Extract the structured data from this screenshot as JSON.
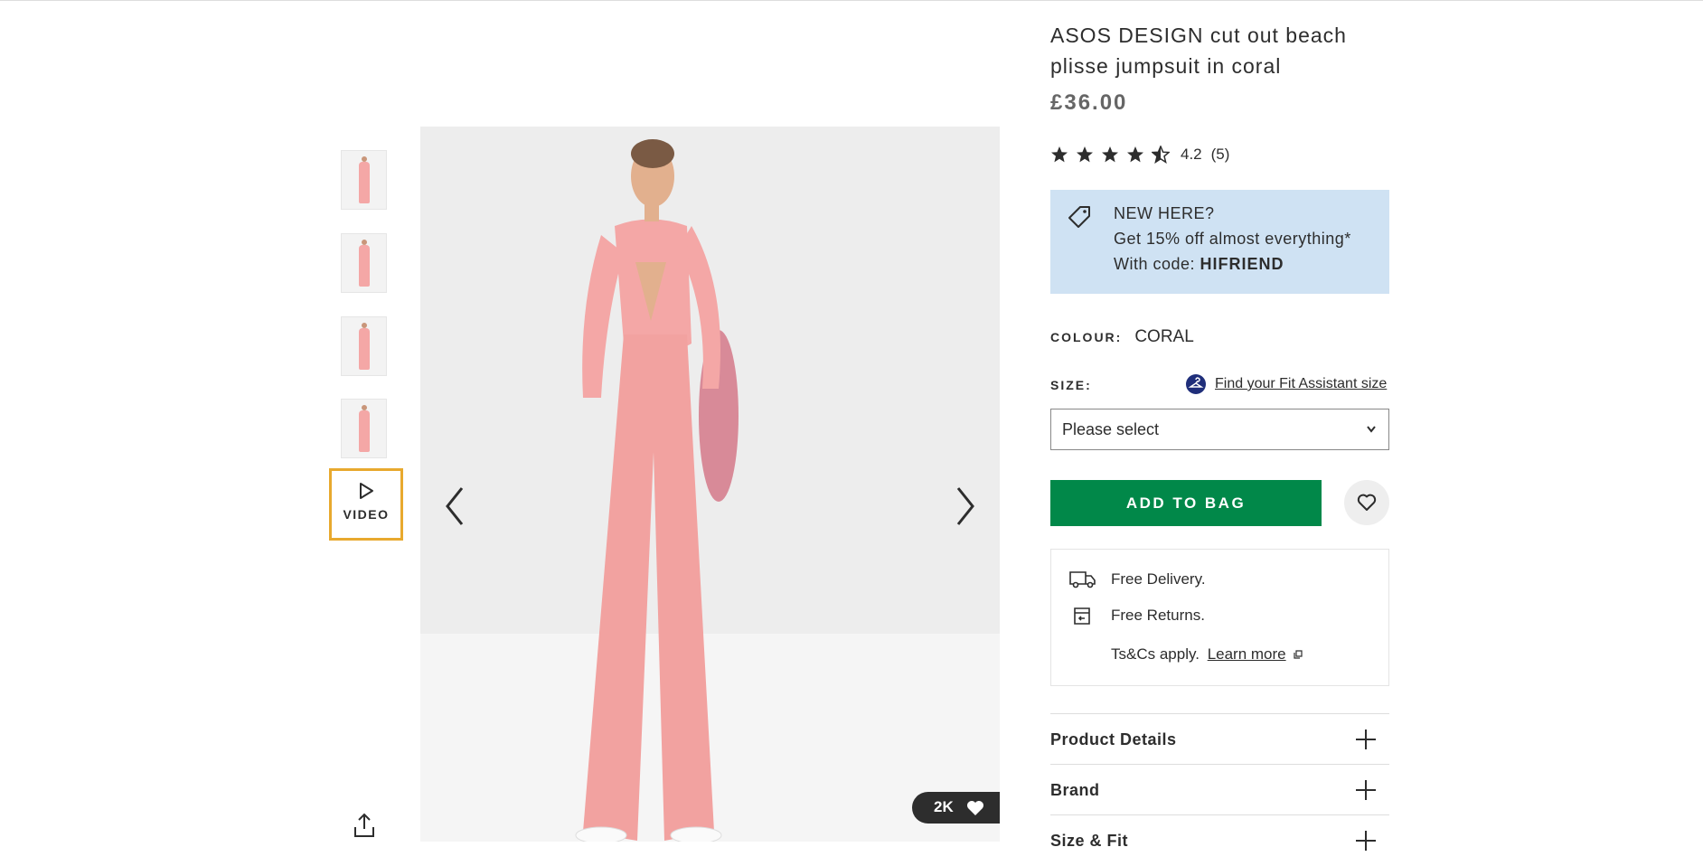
{
  "product": {
    "title": "ASOS DESIGN cut out beach plisse jumpsuit in coral",
    "price": "£36.00",
    "rating": {
      "stars": 4.5,
      "value": "4.2",
      "count": "(5)"
    }
  },
  "promo": {
    "line1": "NEW HERE?",
    "line2": "Get 15% off almost everything*",
    "code_prefix": "With code: ",
    "code": "HIFRIEND"
  },
  "colour": {
    "label": "COLOUR:",
    "value": "CORAL"
  },
  "size": {
    "label": "SIZE:",
    "fit_link": "Find your Fit Assistant size",
    "selected": "Please select"
  },
  "buttons": {
    "add_to_bag": "ADD TO BAG"
  },
  "delivery": {
    "free_delivery": "Free Delivery.",
    "free_returns": "Free Returns.",
    "terms": "Ts&Cs apply.",
    "learn_more": "Learn more"
  },
  "accordions": [
    {
      "label": "Product Details"
    },
    {
      "label": "Brand"
    },
    {
      "label": "Size & Fit"
    }
  ],
  "gallery": {
    "video_label": "VIDEO",
    "saves": "2K"
  },
  "colors": {
    "primary_green": "#018849",
    "promo_bg": "#cfe2f3",
    "video_highlight": "#e8a92e",
    "text": "#2d2d2d"
  }
}
